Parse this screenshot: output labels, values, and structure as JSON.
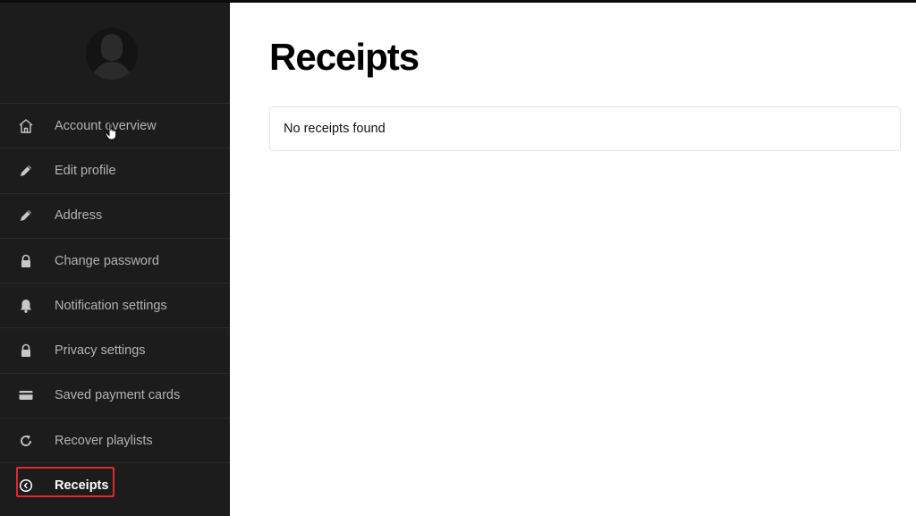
{
  "sidebar": {
    "items": [
      {
        "label": "Account overview",
        "icon": "home-icon"
      },
      {
        "label": "Edit profile",
        "icon": "pencil-icon"
      },
      {
        "label": "Address",
        "icon": "pencil-icon"
      },
      {
        "label": "Change password",
        "icon": "lock-icon"
      },
      {
        "label": "Notification settings",
        "icon": "bell-icon"
      },
      {
        "label": "Privacy settings",
        "icon": "lock-icon"
      },
      {
        "label": "Saved payment cards",
        "icon": "card-icon"
      },
      {
        "label": "Recover playlists",
        "icon": "refresh-icon"
      },
      {
        "label": "Receipts",
        "icon": "clock-icon",
        "active": true
      }
    ]
  },
  "main": {
    "title": "Receipts",
    "empty_message": "No receipts found"
  },
  "colors": {
    "sidebar_bg": "#1c1c1c",
    "nav_text": "#b3b3b3",
    "active_text": "#ffffff",
    "highlight": "#e0282e",
    "main_bg": "#ffffff"
  }
}
